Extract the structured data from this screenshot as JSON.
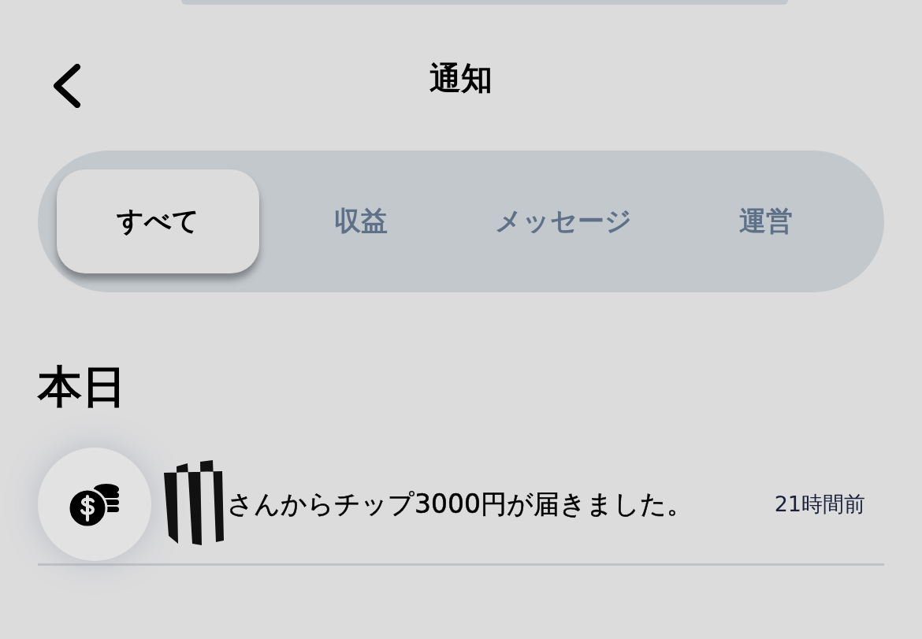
{
  "header": {
    "title": "通知"
  },
  "tabs": [
    {
      "label": "すべて",
      "selected": true
    },
    {
      "label": "収益",
      "selected": false
    },
    {
      "label": "メッセージ",
      "selected": false
    },
    {
      "label": "運営",
      "selected": false
    }
  ],
  "section": {
    "title": "本日"
  },
  "notifications": [
    {
      "kind": "tip",
      "redacted": true,
      "text": "さんからチップ3000円が届きました。",
      "time": "21時間前"
    }
  ]
}
